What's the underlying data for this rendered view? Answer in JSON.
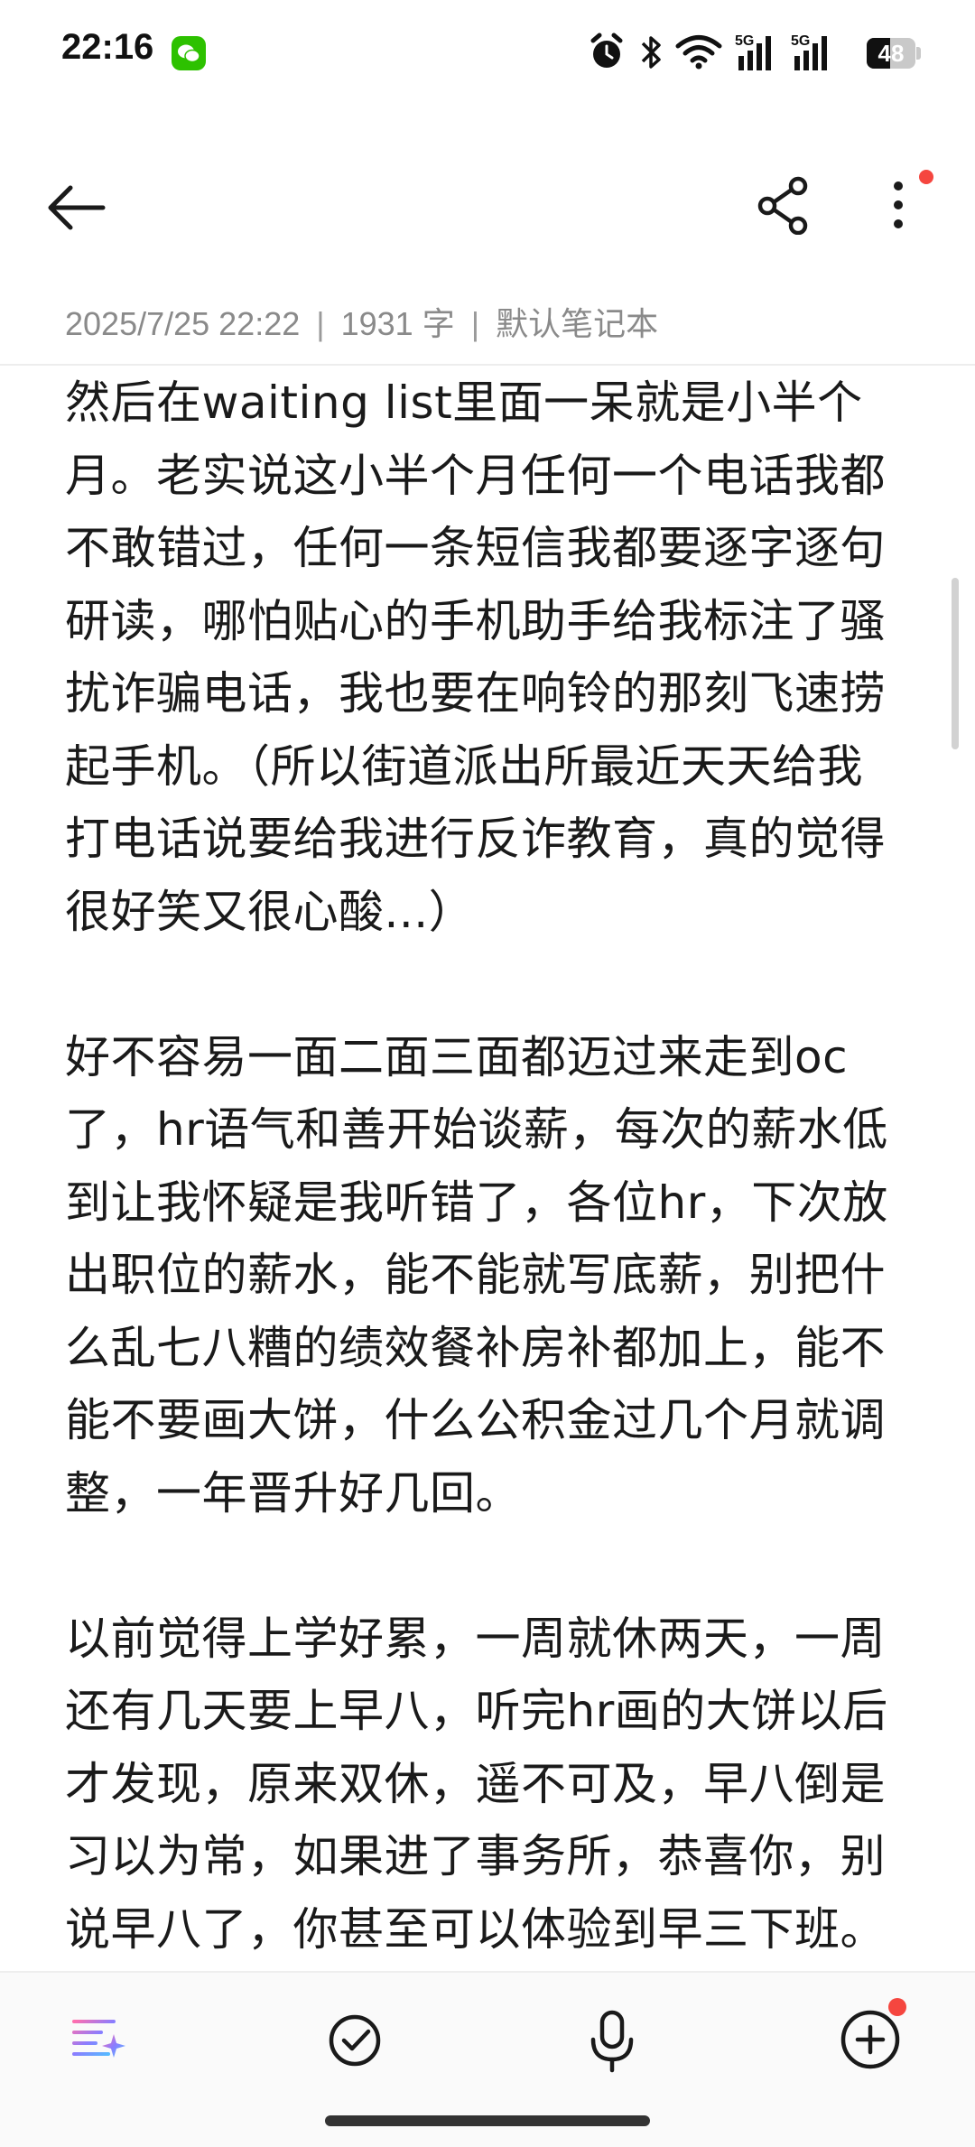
{
  "status_bar": {
    "time": "22:16",
    "battery_level": "48",
    "battery_fraction": 0.48,
    "icons": [
      "wechat-icon",
      "alarm-icon",
      "bluetooth-icon",
      "wifi-icon",
      "5g-signal-icon",
      "5g-signal-icon",
      "battery-icon"
    ]
  },
  "toolbar": {
    "back_icon": "arrow-left-icon",
    "share_icon": "share-icon",
    "more_icon": "more-vertical-icon",
    "notification_dot_color": "#f5463f"
  },
  "note": {
    "date": "2025/7/25 22:22",
    "word_count": "1931 字",
    "notebook": "默认笔记本",
    "separator": "|",
    "paragraphs": [
      "然后在waiting list里面一呆就是小半个月。老实说这小半个月任何一个电话我都不敢错过，任何一条短信我都要逐字逐句研读，哪怕贴心的手机助手给我标注了骚扰诈骗电话，我也要在响铃的那刻飞速捞起手机。（所以街道派出所最近天天给我打电话说要给我进行反诈教育，真的觉得很好笑又很心酸...）",
      "好不容易一面二面三面都迈过来走到oc了，hr语气和善开始谈薪，每次的薪水低到让我怀疑是我听错了，各位hr，下次放出职位的薪水，能不能就写底薪，别把什么乱七八糟的绩效餐补房补都加上，能不能不要画大饼，什么公积金过几个月就调整，一年晋升好几回。",
      "以前觉得上学好累，一周就休两天，一周还有几天要上早八，听完hr画的大饼以后才发现，原来双休，遥不可及，早八倒是习以为常，如果进了事务所，恭喜你，别说早八了，你甚至可以体验到早三下班。"
    ]
  },
  "bottom_bar": {
    "items": [
      "ai-format-icon",
      "checklist-icon",
      "microphone-icon",
      "add-icon"
    ],
    "ai_gradient": [
      "#ff6fae",
      "#8a7dff",
      "#4fc3ff"
    ]
  }
}
